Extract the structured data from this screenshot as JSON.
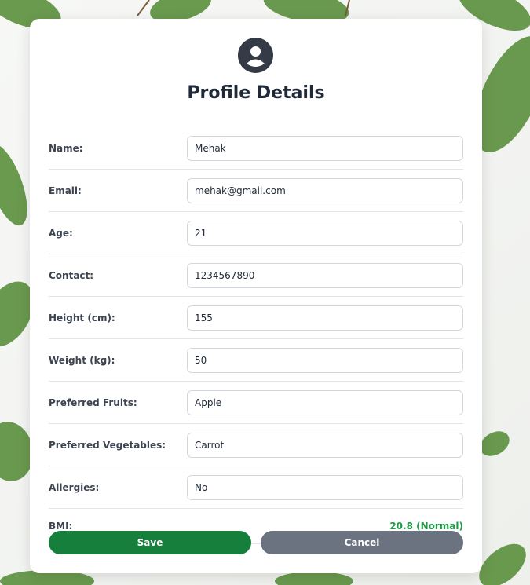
{
  "colors": {
    "accent_save": "#167f3c",
    "cancel": "#6b7280",
    "bmi_value": "#1e9b45",
    "leaf": "#5a8f3c"
  },
  "header": {
    "avatar_icon": "user-circle-icon",
    "title": "Profile Details"
  },
  "fields": [
    {
      "label": "Name:",
      "value": "Mehak"
    },
    {
      "label": "Email:",
      "value": "mehak@gmail.com"
    },
    {
      "label": "Age:",
      "value": "21"
    },
    {
      "label": "Contact:",
      "value": "1234567890"
    },
    {
      "label": "Height (cm):",
      "value": "155"
    },
    {
      "label": "Weight (kg):",
      "value": "50"
    },
    {
      "label": "Preferred Fruits:",
      "value": "Apple"
    },
    {
      "label": "Preferred Vegetables:",
      "value": "Carrot"
    },
    {
      "label": "Allergies:",
      "value": "No"
    }
  ],
  "bmi": {
    "label": "BMI:",
    "value": "20.8 (Normal)"
  },
  "actions": {
    "save_label": "Save",
    "cancel_label": "Cancel"
  }
}
